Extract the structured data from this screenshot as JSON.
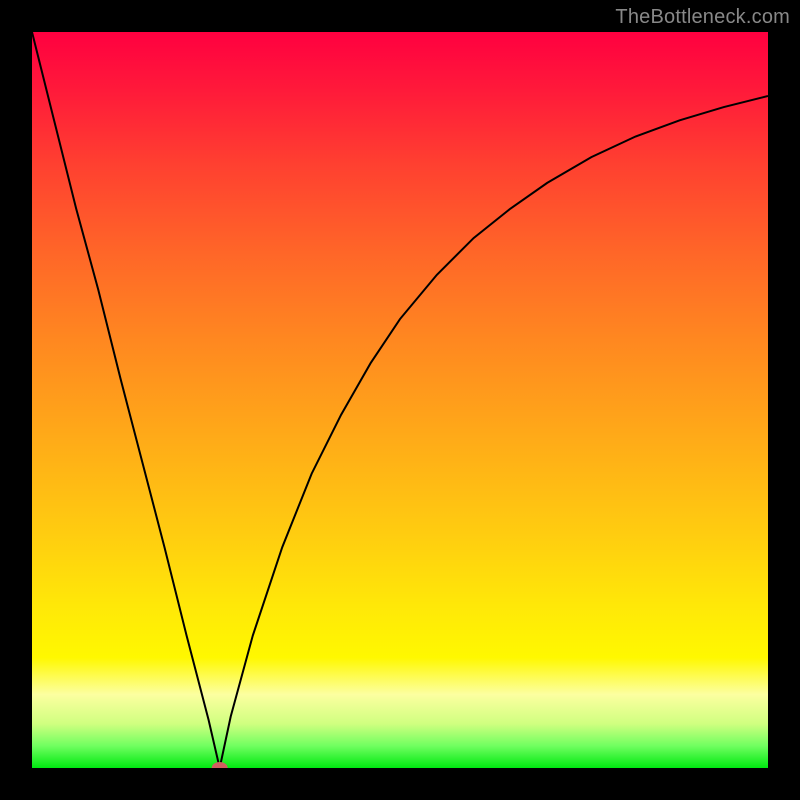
{
  "watermark": "TheBottleneck.com",
  "chart_data": {
    "type": "line",
    "title": "",
    "xlabel": "",
    "ylabel": "",
    "xlim": [
      0,
      100
    ],
    "ylim": [
      0,
      100
    ],
    "grid": false,
    "legend": false,
    "annotations": [],
    "series": [
      {
        "name": "bottleneck-curve",
        "x": [
          0,
          3,
          6,
          9,
          12,
          15,
          18,
          21,
          24,
          25.5,
          27,
          30,
          34,
          38,
          42,
          46,
          50,
          55,
          60,
          65,
          70,
          76,
          82,
          88,
          94,
          100
        ],
        "y": [
          100,
          88,
          76,
          65,
          53,
          41.5,
          30,
          18,
          6.5,
          0,
          7,
          18,
          30,
          40,
          48,
          55,
          61,
          67,
          72,
          76,
          79.5,
          83,
          85.8,
          88,
          89.8,
          91.3
        ]
      }
    ],
    "marker": {
      "x": 25.5,
      "y": 0,
      "color": "#d06060"
    },
    "background_gradient": [
      {
        "pos": 0,
        "color": "#ff0040"
      },
      {
        "pos": 0.5,
        "color": "#ffaa18"
      },
      {
        "pos": 0.85,
        "color": "#fff800"
      },
      {
        "pos": 1.0,
        "color": "#00e810"
      }
    ]
  }
}
